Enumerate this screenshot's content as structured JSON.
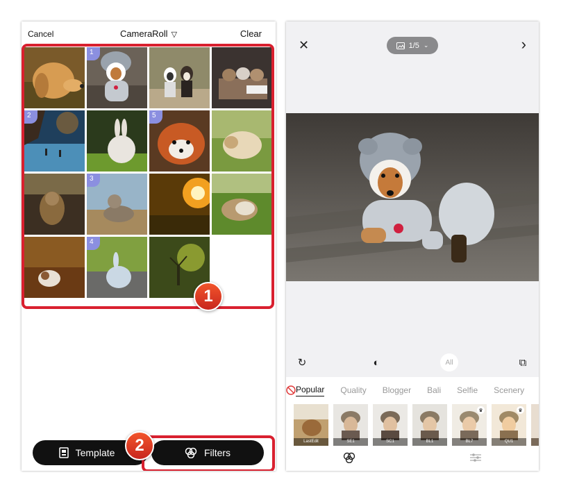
{
  "left": {
    "cancel": "Cancel",
    "title": "CameraRoll",
    "title_arrow": "▽",
    "clear": "Clear",
    "photos": [
      {
        "num": "",
        "selected": false,
        "desc": "golden-retriever"
      },
      {
        "num": "1",
        "selected": true,
        "desc": "dog-in-hat"
      },
      {
        "num": "",
        "selected": false,
        "desc": "puppies"
      },
      {
        "num": "",
        "selected": false,
        "desc": "kittens-basket"
      },
      {
        "num": "2",
        "selected": true,
        "desc": "deer-lake"
      },
      {
        "num": "",
        "selected": false,
        "desc": "white-rabbit"
      },
      {
        "num": "5",
        "selected": true,
        "desc": "red-panda"
      },
      {
        "num": "",
        "selected": false,
        "desc": "guinea-pig"
      },
      {
        "num": "",
        "selected": false,
        "desc": "monkey"
      },
      {
        "num": "3",
        "selected": true,
        "desc": "tabby-cat"
      },
      {
        "num": "",
        "selected": false,
        "desc": "sunset-forest"
      },
      {
        "num": "",
        "selected": false,
        "desc": "hamster"
      },
      {
        "num": "",
        "selected": false,
        "desc": "autumn-dog"
      },
      {
        "num": "4",
        "selected": true,
        "desc": "bunny"
      },
      {
        "num": "",
        "selected": false,
        "desc": "deer-forest"
      },
      {
        "num": "",
        "selected": false,
        "desc": "empty"
      }
    ],
    "template_label": "Template",
    "filters_label": "Filters",
    "badge1": "1",
    "badge2": "2"
  },
  "right": {
    "counter": "1/5",
    "tool_all": "All",
    "categories": [
      "Popular",
      "Quality",
      "Blogger",
      "Bali",
      "Selfie",
      "Scenery"
    ],
    "filters": [
      {
        "label": "LastEdit",
        "crown": false
      },
      {
        "label": "SE1",
        "crown": false
      },
      {
        "label": "SC1",
        "crown": false
      },
      {
        "label": "BL1",
        "crown": false
      },
      {
        "label": "BL7",
        "crown": true
      },
      {
        "label": "QU1",
        "crown": true
      },
      {
        "label": "",
        "crown": false
      }
    ]
  },
  "colors": {
    "highlight_red": "#d9202f",
    "selection_pink": "#d99bc6",
    "number_badge": "#8b8fe0",
    "button_dark": "#111111"
  }
}
